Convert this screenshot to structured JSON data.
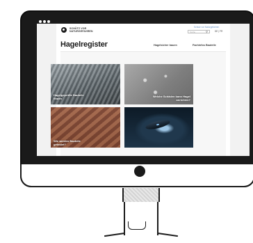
{
  "site": {
    "logo_line1": "SCHÜTZ VOR",
    "logo_line2": "NATURGEFAHREN",
    "top_link": "Schutz vor Naturgefahren",
    "search_placeholder": "Suche",
    "search_icon": "search-icon",
    "language": "DE | FR",
    "title": "Hagelregister",
    "nav": [
      "Hagelsicher bauen",
      "Fachinfos Bauteile"
    ]
  },
  "tiles": [
    {
      "label": "Hagelgeprüfte Bauteile finden"
    },
    {
      "label": "Welche Schäden kann Hagel anrichten?"
    },
    {
      "label": "Wie werden Bauteile getestet?"
    },
    {
      "label": ""
    }
  ],
  "colors": {
    "link": "#6a94c9",
    "monitor": "#1a1a1a"
  }
}
